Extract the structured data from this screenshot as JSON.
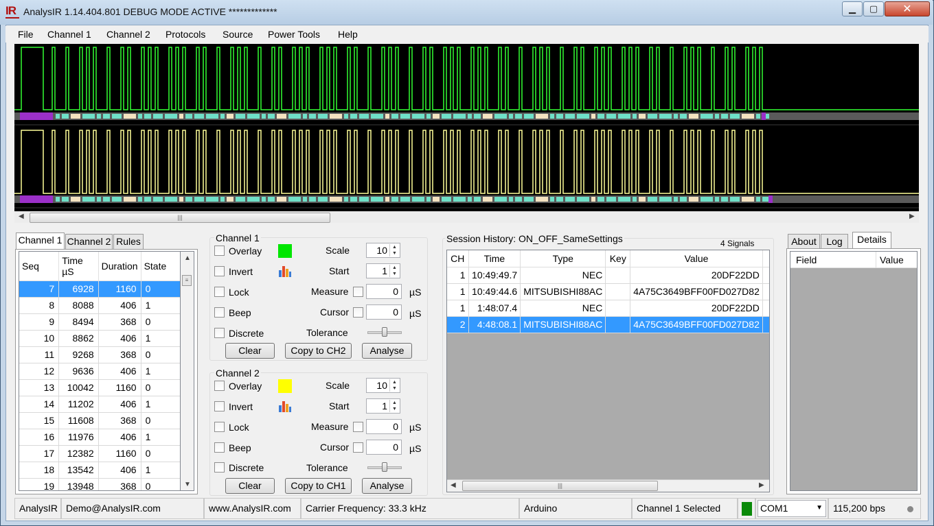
{
  "window": {
    "logo": "IR",
    "title": "AnalysIR 1.14.404.801 DEBUG MODE ACTIVE *************",
    "min_glyph": "▁",
    "max_glyph": "▢",
    "close_glyph": "✕"
  },
  "menu": [
    "File",
    "Channel 1",
    "Channel 2",
    "Protocols",
    "Source",
    "Power Tools",
    "Help"
  ],
  "waveform": {
    "ch1_color": "#33ff33",
    "ch2_color": "#ffff99"
  },
  "left_tabs": [
    "Channel 1",
    "Channel 2",
    "Rules"
  ],
  "seq_table": {
    "headers": [
      "Seq",
      "Time µS",
      "Duration",
      "State"
    ],
    "rows": [
      [
        "7",
        "6928",
        "1160",
        "0"
      ],
      [
        "8",
        "8088",
        "406",
        "1"
      ],
      [
        "9",
        "8494",
        "368",
        "0"
      ],
      [
        "10",
        "8862",
        "406",
        "1"
      ],
      [
        "11",
        "9268",
        "368",
        "0"
      ],
      [
        "12",
        "9636",
        "406",
        "1"
      ],
      [
        "13",
        "10042",
        "1160",
        "0"
      ],
      [
        "14",
        "11202",
        "406",
        "1"
      ],
      [
        "15",
        "11608",
        "368",
        "0"
      ],
      [
        "16",
        "11976",
        "406",
        "1"
      ],
      [
        "17",
        "12382",
        "1160",
        "0"
      ],
      [
        "18",
        "13542",
        "406",
        "1"
      ],
      [
        "19",
        "13948",
        "368",
        "0"
      ]
    ]
  },
  "channel1": {
    "title": "Channel 1",
    "overlay": "Overlay",
    "invert": "Invert",
    "lock": "Lock",
    "beep": "Beep",
    "discrete": "Discrete",
    "scale_label": "Scale",
    "scale": "10",
    "start_label": "Start",
    "start": "1",
    "measure_label": "Measure",
    "measure": "0",
    "cursor_label": "Cursor",
    "cursor": "0",
    "tolerance_label": "Tolerance",
    "unit": "µS",
    "swatch_color": "#00e600",
    "clear": "Clear",
    "copy": "Copy to CH2",
    "analyse": "Analyse"
  },
  "channel2": {
    "title": "Channel 2",
    "overlay": "Overlay",
    "invert": "Invert",
    "lock": "Lock",
    "beep": "Beep",
    "discrete": "Discrete",
    "scale_label": "Scale",
    "scale": "10",
    "start_label": "Start",
    "start": "1",
    "measure_label": "Measure",
    "measure": "0",
    "cursor_label": "Cursor",
    "cursor": "0",
    "tolerance_label": "Tolerance",
    "unit": "µS",
    "swatch_color": "#ffff00",
    "clear": "Clear",
    "copy": "Copy to CH1",
    "analyse": "Analyse"
  },
  "session": {
    "title": "Session History: ON_OFF_SameSettings",
    "count": "4 Signals",
    "headers": [
      "CH",
      "Time",
      "Type",
      "Key",
      "Value"
    ],
    "rows": [
      [
        "1",
        "10:49:49.7",
        "NEC",
        "",
        "20DF22DD"
      ],
      [
        "1",
        "10:49:44.6",
        "MITSUBISHI88AC",
        "",
        "4A75C3649BFF00FD027D82"
      ],
      [
        "1",
        "1:48:07.4",
        "NEC",
        "",
        "20DF22DD"
      ],
      [
        "2",
        "4:48:08.1",
        "MITSUBISHI88AC",
        "",
        "4A75C3649BFF00FD027D82"
      ]
    ]
  },
  "right_tabs": [
    "About",
    "Log",
    "Details"
  ],
  "details": {
    "headers": [
      "Field",
      "Value"
    ]
  },
  "status": {
    "app": "AnalysIR",
    "email": "Demo@AnalysIR.com",
    "website": "www.AnalysIR.com",
    "carrier": "Carrier Frequency: 33.3 kHz",
    "source": "Arduino",
    "selected": "Channel 1 Selected",
    "port": "COM1",
    "baud": "115,200 bps",
    "indicator_color": "#0a8a0a"
  }
}
